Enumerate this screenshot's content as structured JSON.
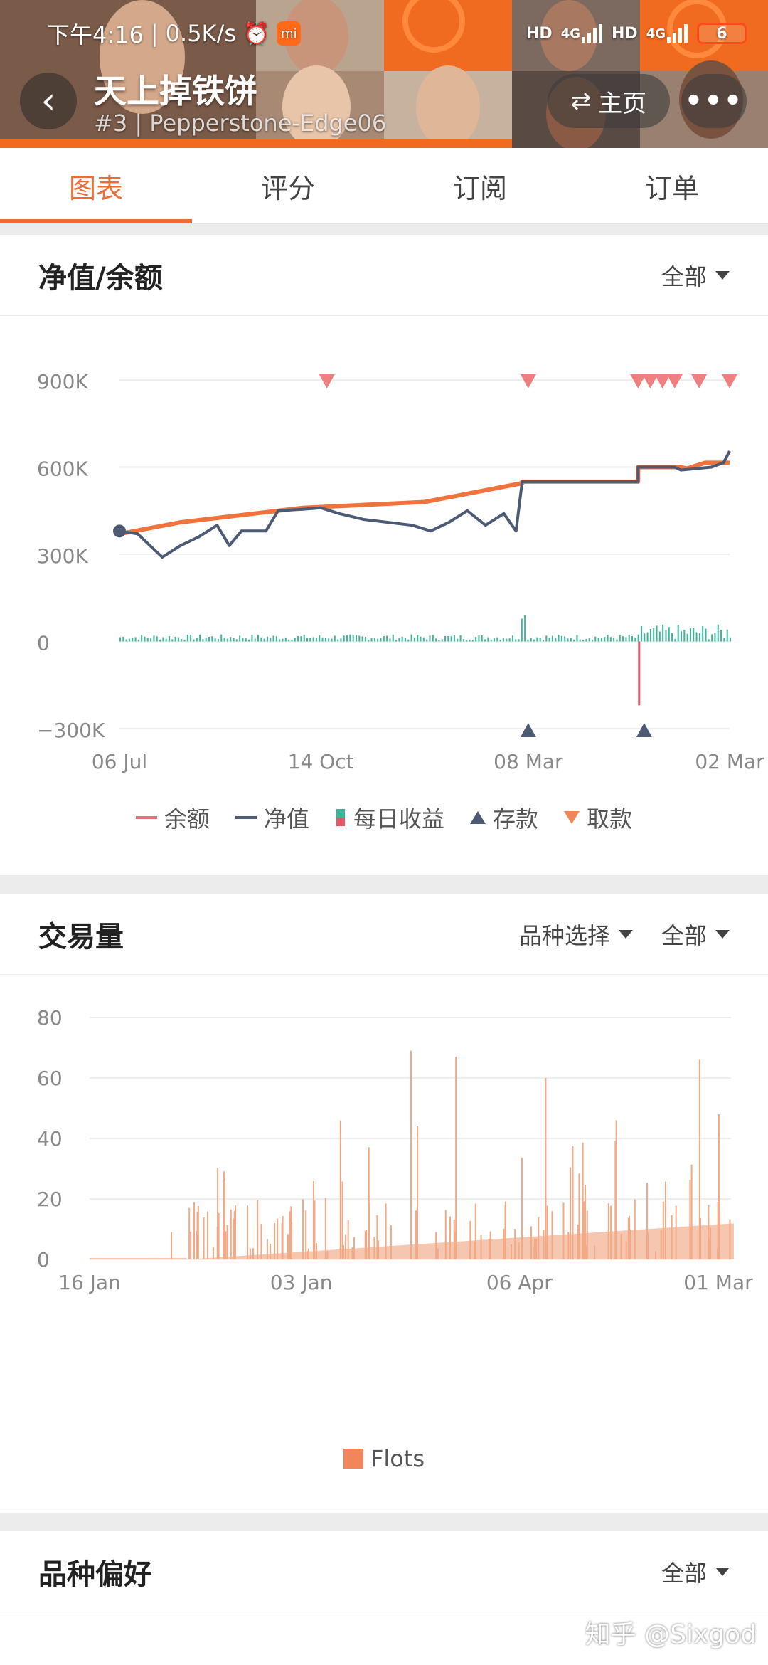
{
  "status_bar": {
    "time": "下午4:16",
    "speed": "0.5K/s",
    "network1": "HD",
    "signal1": "4G",
    "network2": "HD",
    "signal2": "4G",
    "battery": "6"
  },
  "header": {
    "title": "天上掉铁饼",
    "subtitle": "#3 | Pepperstone-Edge06",
    "home_label": "主页",
    "more_label": "•••"
  },
  "tabs": [
    {
      "label": "图表",
      "active": true
    },
    {
      "label": "评分",
      "active": false
    },
    {
      "label": "订阅",
      "active": false
    },
    {
      "label": "订单",
      "active": false
    }
  ],
  "equity_card": {
    "title": "净值/余额",
    "filter": "全部",
    "legend": [
      {
        "label": "余额",
        "color": "#e8727a",
        "icon": "line"
      },
      {
        "label": "净值",
        "color": "#4c5a73",
        "icon": "line"
      },
      {
        "label": "每日收益",
        "color": "#3bb49a",
        "icon": "bars"
      },
      {
        "label": "存款",
        "color": "#4c5a73",
        "icon": "triangle-up"
      },
      {
        "label": "取款",
        "color": "#f2865a",
        "icon": "triangle-down"
      }
    ]
  },
  "volume_card": {
    "title": "交易量",
    "filter1": "品种选择",
    "filter2": "全部",
    "legend_label": "Flots",
    "legend_color": "#f2865a"
  },
  "preference_card": {
    "title": "品种偏好",
    "filter": "全部"
  },
  "watermark": "知乎 @Sixgod",
  "chart_data": [
    {
      "type": "line",
      "y_ticks": [
        "900K",
        "600K",
        "300K",
        "0",
        "−300K"
      ],
      "ylim": [
        -300000,
        900000
      ],
      "x_ticks": [
        "06 Jul",
        "14 Oct",
        "08 Mar",
        "02 Mar"
      ],
      "series": [
        {
          "name": "余额",
          "color": "#f0733d",
          "points": [
            [
              0,
              370000
            ],
            [
              0.1,
              410000
            ],
            [
              0.3,
              460000
            ],
            [
              0.5,
              480000
            ],
            [
              0.66,
              545000
            ],
            [
              0.66,
              550000
            ],
            [
              0.85,
              550000
            ],
            [
              0.85,
              600000
            ],
            [
              0.92,
              600000
            ],
            [
              0.93,
              595000
            ],
            [
              0.96,
              615000
            ],
            [
              1,
              615000
            ]
          ]
        },
        {
          "name": "净值",
          "color": "#4c5a73",
          "points": [
            [
              0,
              380000
            ],
            [
              0.03,
              370000
            ],
            [
              0.07,
              290000
            ],
            [
              0.1,
              330000
            ],
            [
              0.13,
              360000
            ],
            [
              0.16,
              400000
            ],
            [
              0.18,
              330000
            ],
            [
              0.2,
              380000
            ],
            [
              0.24,
              380000
            ],
            [
              0.26,
              450000
            ],
            [
              0.3,
              455000
            ],
            [
              0.33,
              460000
            ],
            [
              0.36,
              440000
            ],
            [
              0.4,
              420000
            ],
            [
              0.44,
              410000
            ],
            [
              0.48,
              400000
            ],
            [
              0.51,
              380000
            ],
            [
              0.54,
              410000
            ],
            [
              0.57,
              450000
            ],
            [
              0.6,
              400000
            ],
            [
              0.63,
              440000
            ],
            [
              0.65,
              380000
            ],
            [
              0.66,
              550000
            ],
            [
              0.85,
              550000
            ],
            [
              0.85,
              600000
            ],
            [
              0.91,
              600000
            ],
            [
              0.92,
              590000
            ],
            [
              0.97,
              600000
            ],
            [
              0.99,
              615000
            ],
            [
              1,
              655000
            ]
          ]
        }
      ],
      "daily_profit": {
        "color_pos": "#3bb49a",
        "color_neg": "#e15866",
        "large_negative": {
          "x": 0.85,
          "value": -220000
        }
      },
      "deposits_x": [
        0.67,
        0.86
      ],
      "withdrawals_x": [
        0.34,
        0.67,
        0.85,
        0.87,
        0.89,
        0.91,
        0.95,
        1.0
      ]
    },
    {
      "type": "bar",
      "y_ticks": [
        "80",
        "60",
        "40",
        "20",
        "0"
      ],
      "ylim": [
        0,
        80
      ],
      "x_ticks": [
        "16 Jan",
        "03 Jan",
        "06 Apr",
        "01 Mar"
      ],
      "series": [
        {
          "name": "Flots",
          "color": "#f2a985"
        }
      ]
    }
  ]
}
